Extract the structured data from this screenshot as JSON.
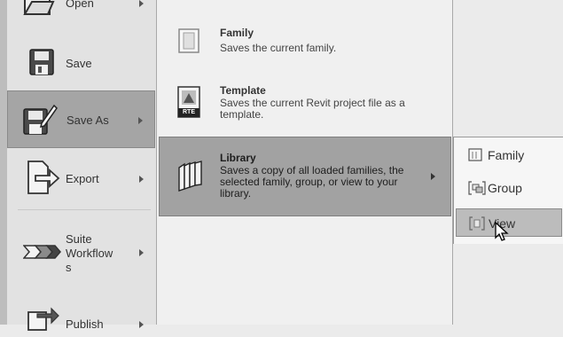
{
  "left_menu": {
    "open_label": "Open",
    "save_label": "Save",
    "save_as_label": "Save As",
    "export_label": "Export",
    "suite_workflows_label": "Suite\nWorkflow\ns",
    "publish_label": "Publish"
  },
  "save_as_menu": {
    "family": {
      "title": "Family",
      "desc": "Saves the current family."
    },
    "template": {
      "title": "Template",
      "desc": "Saves the current Revit project file as a template.",
      "badge": "RTE"
    },
    "library": {
      "title": "Library",
      "desc": "Saves a copy of all loaded families, the selected family, group, or view to your library."
    }
  },
  "library_flyout": {
    "family_label": "Family",
    "group_label": "Group",
    "view_label": "View"
  },
  "icons": {
    "open": "folder-open-icon",
    "save": "floppy-disk-icon",
    "save_as": "floppy-pencil-icon",
    "export": "document-arrow-icon",
    "suite": "chevron-workflow-icon",
    "publish": "publish-icon",
    "family": "family-file-icon",
    "template": "template-file-icon",
    "library": "library-books-icon",
    "cursor": "mouse-pointer-icon"
  }
}
